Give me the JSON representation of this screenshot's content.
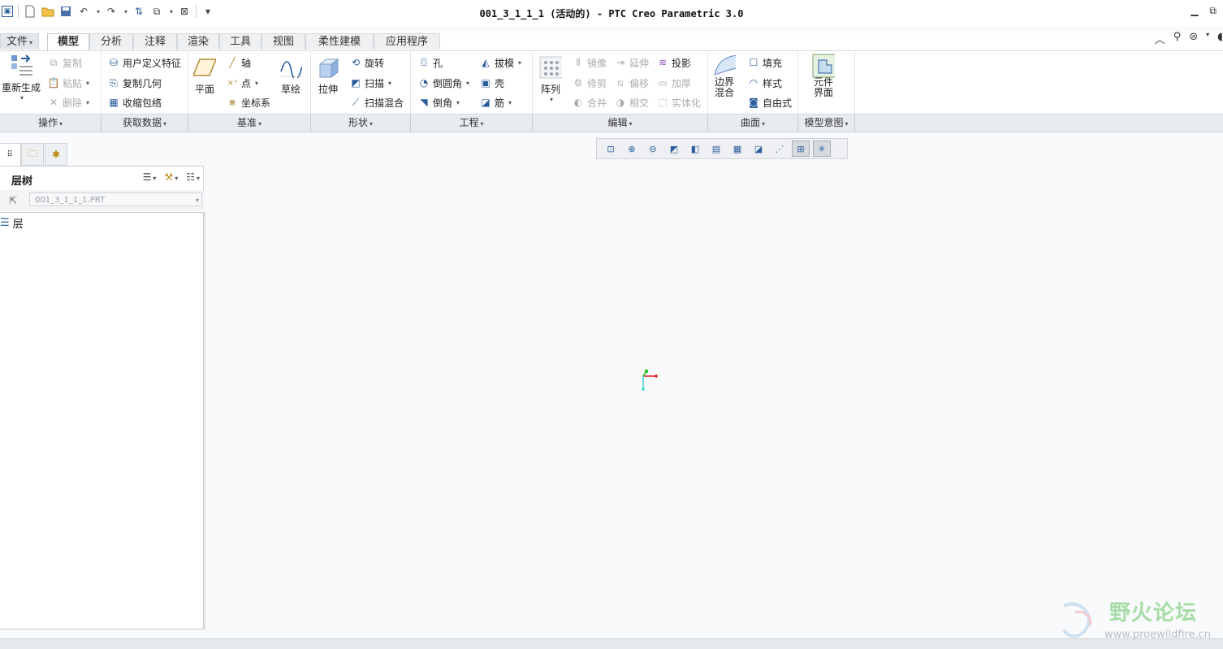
{
  "window": {
    "title": "001_3_1_1_1 (活动的) - PTC Creo Parametric 3.0",
    "controls": {
      "minimize": "▭",
      "restore": "⧉"
    }
  },
  "quick_access": [
    {
      "icon": "app-icon",
      "glyph": "▣"
    },
    {
      "icon": "new-file-icon",
      "glyph": "🗋"
    },
    {
      "icon": "open-folder-icon",
      "glyph": "📂"
    },
    {
      "icon": "save-icon",
      "glyph": "💾"
    },
    {
      "icon": "undo-icon",
      "glyph": "↶"
    },
    {
      "icon": "redo-icon",
      "glyph": "↷"
    },
    {
      "icon": "regenerate-icon",
      "glyph": "⇅"
    },
    {
      "icon": "windows-icon",
      "glyph": "⧉"
    },
    {
      "icon": "close-window-icon",
      "glyph": "⊠"
    },
    {
      "icon": "customize-icon",
      "glyph": "▾"
    }
  ],
  "tabs": [
    {
      "label": "文件",
      "dropdown": "▾"
    },
    {
      "label": "模型"
    },
    {
      "label": "分析"
    },
    {
      "label": "注释"
    },
    {
      "label": "渲染"
    },
    {
      "label": "工具"
    },
    {
      "label": "视图"
    },
    {
      "label": "柔性建模"
    },
    {
      "label": "应用程序"
    }
  ],
  "ribbon": {
    "operations": {
      "regenerate": "重新生成",
      "copy": "复制",
      "paste": "粘贴",
      "delete": "删除",
      "group": "操作"
    },
    "get_data": {
      "udf": "用户定义特征",
      "copy_geom": "复制几何",
      "shrinkwrap": "收缩包络",
      "group": "获取数据"
    },
    "datum": {
      "plane": "平面",
      "axis": "轴",
      "point": "点",
      "csys": "坐标系",
      "sketch": "草绘",
      "group": "基准"
    },
    "shapes": {
      "extrude": "拉伸",
      "revolve": "旋转",
      "sweep": "扫描",
      "swept_blend": "扫描混合",
      "group": "形状"
    },
    "engineering": {
      "hole": "孔",
      "round": "倒圆角",
      "chamfer": "倒角",
      "draft": "拔模",
      "shell": "壳",
      "rib": "筋",
      "group": "工程"
    },
    "editing": {
      "pattern": "阵列",
      "mirror": "镜像",
      "extend": "延伸",
      "project": "投影",
      "trim": "修剪",
      "offset": "偏移",
      "thicken": "加厚",
      "merge": "合并",
      "intersect": "相交",
      "solidify": "实体化",
      "group": "编辑"
    },
    "surfaces": {
      "boundary_blend": "边界混合",
      "fill": "填充",
      "style": "样式",
      "freestyle": "自由式",
      "group": "曲面"
    },
    "model_intent": {
      "component_interface": "元件界面",
      "group": "模型意图"
    }
  },
  "panel": {
    "tabs": [
      "model-tree-tab",
      "folder-browser-tab",
      "favorites-tab"
    ],
    "title": "层树",
    "combo_value": "001_3_1_1_1.PRT",
    "tree_items": [
      {
        "label": "层"
      }
    ]
  },
  "view_toolbar": [
    "refit-icon",
    "zoom-in-icon",
    "zoom-out-icon",
    "repaint-icon",
    "display-style-icon",
    "saved-views-icon",
    "view-manager-icon",
    "perspective-icon",
    "annotation-display-icon",
    "datum-display-icon",
    "spin-center-icon"
  ],
  "watermark": {
    "text": "野火论坛",
    "url": "www.proewildfire.cn"
  },
  "colors": {
    "accent": "#2a5d9c",
    "axis_x": "#e02020",
    "axis_y": "#20c020",
    "axis_z": "#40d0d0"
  }
}
